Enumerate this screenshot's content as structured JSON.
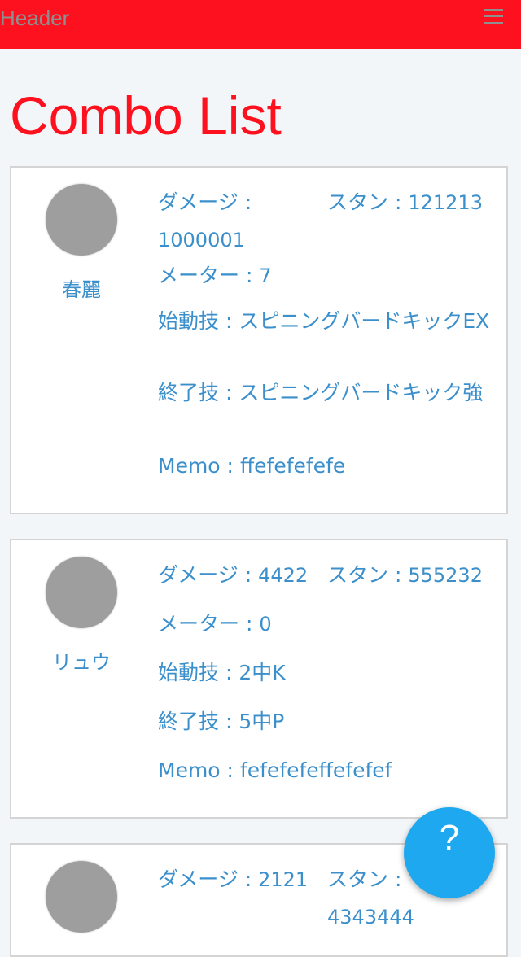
{
  "header": {
    "title": "Header",
    "menu_icon": "hamburger-menu-icon"
  },
  "page": {
    "title": "Combo List"
  },
  "labels": {
    "damage": "ダメージ",
    "stun": "スタン",
    "meter": "メーター",
    "start": "始動技",
    "end": "終了技",
    "memo": "Memo",
    "sep": " : "
  },
  "combos": [
    {
      "character": "春麗",
      "damage": "1000001",
      "stun": "121213",
      "meter": "7",
      "start_move": "スピニングバードキックEX",
      "end_move": "スピニングバードキック強",
      "memo": "ffefefefefe"
    },
    {
      "character": "リュウ",
      "damage": "4422",
      "stun": "555232",
      "meter": "0",
      "start_move": "2中K",
      "end_move": "5中P",
      "memo": "fefefefeffefefef"
    },
    {
      "character": "",
      "damage": "2121",
      "stun": "4343444",
      "meter": "",
      "start_move": "",
      "end_move": "",
      "memo": ""
    }
  ],
  "fab": {
    "label": "?"
  },
  "colors": {
    "header_bg": "#fe111f",
    "title": "#fe111f",
    "field_text": "#3b8fcb",
    "fab_bg": "#1da8f0",
    "avatar": "#9e9e9e"
  }
}
